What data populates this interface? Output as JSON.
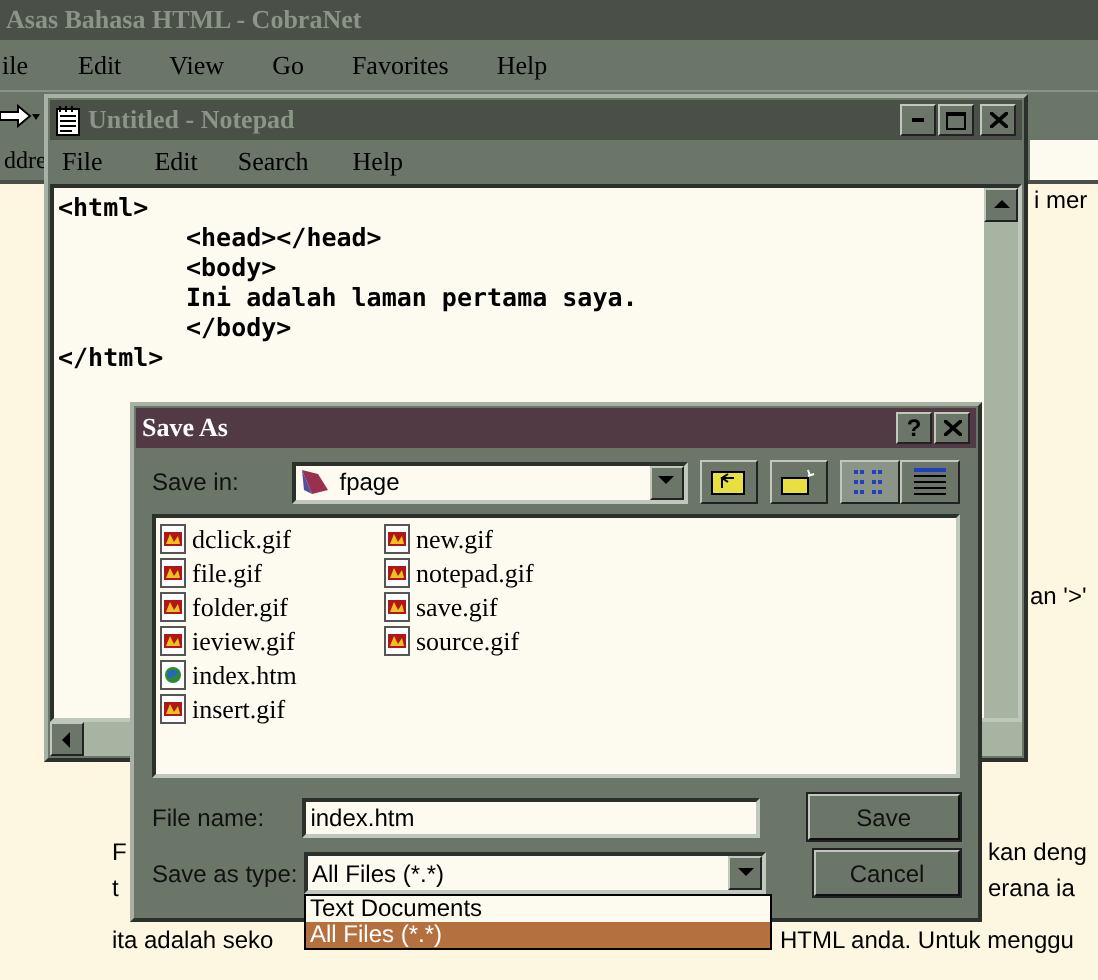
{
  "browser": {
    "title": "Asas Bahasa HTML - CobraNet",
    "menu": [
      "ile",
      "Edit",
      "View",
      "Go",
      "Favorites",
      "Help"
    ],
    "address_label": "ddre",
    "page_fragments": [
      "i mer",
      "an '>'",
      "F",
      "kan deng",
      "t",
      "erana ia",
      "ita adalah seko",
      "HTML anda. Untuk menggu"
    ]
  },
  "notepad": {
    "title": "Untitled - Notepad",
    "menu": [
      "File",
      "Edit",
      "Search",
      "Help"
    ],
    "lines": [
      {
        "text": "<html>",
        "indented": false
      },
      {
        "text": "<head></head>",
        "indented": true
      },
      {
        "text": "<body>",
        "indented": true
      },
      {
        "text": "Ini adalah laman pertama saya.",
        "indented": true
      },
      {
        "text": "</body>",
        "indented": true
      },
      {
        "text": "</html>",
        "indented": false
      }
    ]
  },
  "dialog": {
    "title": "Save As",
    "help_button": "?",
    "save_in_label": "Save in:",
    "folder": "fpage",
    "files": [
      {
        "name": "dclick.gif",
        "kind": "image"
      },
      {
        "name": "file.gif",
        "kind": "image"
      },
      {
        "name": "folder.gif",
        "kind": "image"
      },
      {
        "name": "ieview.gif",
        "kind": "image"
      },
      {
        "name": "index.htm",
        "kind": "web"
      },
      {
        "name": "insert.gif",
        "kind": "image"
      },
      {
        "name": "new.gif",
        "kind": "image"
      },
      {
        "name": "notepad.gif",
        "kind": "image"
      },
      {
        "name": "save.gif",
        "kind": "image"
      },
      {
        "name": "source.gif",
        "kind": "image"
      }
    ],
    "file_name_label": "File name:",
    "file_name": "index.htm",
    "type_label": "Save as type:",
    "type": "All Files (*.*)",
    "type_options": [
      {
        "label": "Text Documents",
        "selected": false
      },
      {
        "label": "All Files (*.*)",
        "selected": true
      }
    ],
    "buttons": [
      "Save",
      "Cancel"
    ]
  }
}
